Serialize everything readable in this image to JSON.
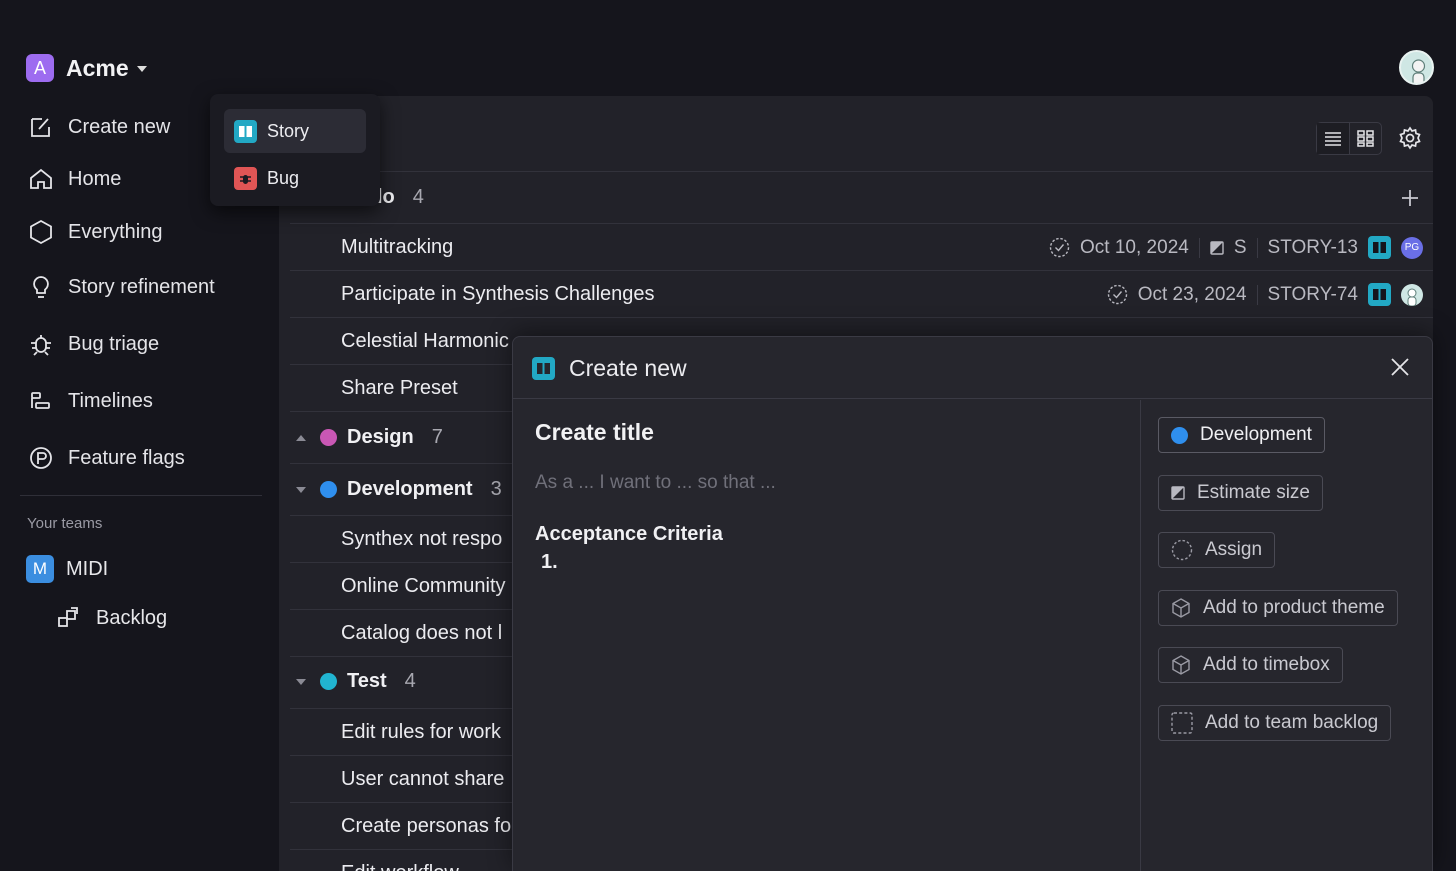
{
  "brand": {
    "badge": "A",
    "name": "Acme"
  },
  "sidebar": {
    "items": [
      {
        "label": "Create new",
        "icon": "create-new-icon"
      },
      {
        "label": "Home",
        "icon": "home-icon"
      },
      {
        "label": "Everything",
        "icon": "hexagon-icon"
      },
      {
        "label": "Story refinement",
        "icon": "lightbulb-icon"
      },
      {
        "label": "Bug triage",
        "icon": "bug-icon"
      },
      {
        "label": "Timelines",
        "icon": "timeline-icon"
      },
      {
        "label": "Feature flags",
        "icon": "flag-icon"
      }
    ],
    "teams_label": "Your teams",
    "team": {
      "badge": "M",
      "name": "MIDI"
    },
    "backlog": "Backlog"
  },
  "dropdown": {
    "items": [
      {
        "label": "Story",
        "icon": "story-icon",
        "color": "#22a8c4"
      },
      {
        "label": "Bug",
        "icon": "bug-icon",
        "color": "#e05555"
      }
    ]
  },
  "list": {
    "group_todo": {
      "name": "lo",
      "count": "4"
    },
    "rows_todo": [
      {
        "title": "Multitracking",
        "date": "Oct 10, 2024",
        "size": "S",
        "id": "STORY-13",
        "avatar": "PG"
      },
      {
        "title": "Participate in Synthesis Challenges",
        "date": "Oct 23, 2024",
        "id": "STORY-74"
      },
      {
        "title": "Celestial Harmonic"
      },
      {
        "title": "Share Preset"
      }
    ],
    "group_design": {
      "name": "Design",
      "count": "7",
      "color": "#c957b4"
    },
    "group_dev": {
      "name": "Development",
      "count": "3",
      "color": "#2f8fee"
    },
    "rows_dev": [
      {
        "title": "Synthex not respo"
      },
      {
        "title": "Online Community"
      },
      {
        "title": "Catalog does not l"
      }
    ],
    "group_test": {
      "name": "Test",
      "count": "4",
      "color": "#21b4d0"
    },
    "rows_test": [
      {
        "title": "Edit rules for work"
      },
      {
        "title": "User cannot share"
      },
      {
        "title": "Create personas fo"
      },
      {
        "title": "Edit workflow"
      }
    ]
  },
  "modal": {
    "title": "Create new",
    "field_title": "Create title",
    "placeholder": "As a ... I want to ... so that ...",
    "acceptance": "Acceptance Criteria",
    "list_item": "1.",
    "chips": [
      {
        "label": "Development",
        "icon": "status-dot-icon",
        "color": "#2f8fee"
      },
      {
        "label": "Estimate size",
        "icon": "size-icon"
      },
      {
        "label": "Assign",
        "icon": "assign-icon"
      },
      {
        "label": "Add to product theme",
        "icon": "cube-icon"
      },
      {
        "label": "Add to timebox",
        "icon": "cube-icon"
      },
      {
        "label": "Add to team backlog",
        "icon": "dashed-square-icon"
      }
    ]
  }
}
